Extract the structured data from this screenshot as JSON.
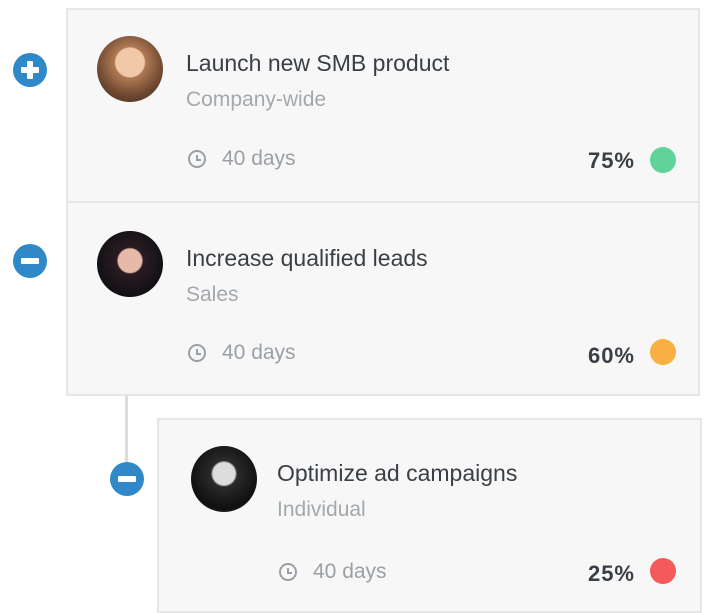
{
  "goals": [
    {
      "title": "Launch new SMB product",
      "scope": "Company-wide",
      "duration": "40 days",
      "progress_label": "75%",
      "progress": 0.75,
      "status_color": "#5fd39a",
      "toggle": "expand",
      "avatar_icon": "user-avatar"
    },
    {
      "title": "Increase qualified leads",
      "scope": "Sales",
      "duration": "40 days",
      "progress_label": "60%",
      "progress": 0.6,
      "status_color": "#f8b042",
      "toggle": "collapse",
      "avatar_icon": "user-avatar"
    },
    {
      "title": "Optimize ad campaigns",
      "scope": "Individual",
      "duration": "40 days",
      "progress_label": "25%",
      "progress": 0.25,
      "status_color": "#f45a5a",
      "toggle": "collapse",
      "avatar_icon": "user-avatar"
    }
  ],
  "colors": {
    "toggle_button": "#2f88c8",
    "card_bg": "#f7f7f7",
    "card_border": "#e6e6e6",
    "title_text": "#3a3f45",
    "muted_text": "#a3a8ad"
  }
}
